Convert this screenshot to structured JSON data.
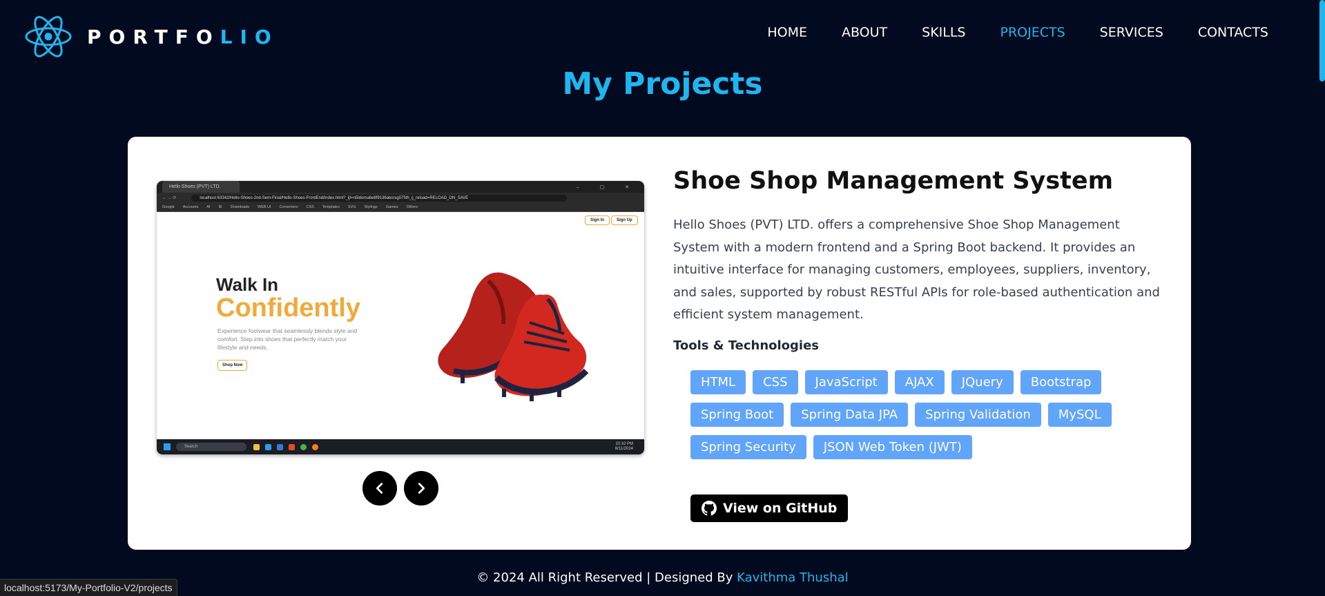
{
  "header": {
    "logo_icon": "react-atom-icon",
    "logo_text_main": "PORTFO",
    "logo_text_accent": "LIO",
    "nav": [
      {
        "label": "HOME",
        "active": false
      },
      {
        "label": "ABOUT",
        "active": false
      },
      {
        "label": "SKILLS",
        "active": false
      },
      {
        "label": "PROJECTS",
        "active": true
      },
      {
        "label": "SERVICES",
        "active": false
      },
      {
        "label": "CONTACTS",
        "active": false
      }
    ]
  },
  "section": {
    "title": "My Projects"
  },
  "project": {
    "title": "Shoe Shop Management System",
    "description": "Hello Shoes (PVT) LTD. offers a comprehensive Shoe Shop Management System with a modern frontend and a Spring Boot backend. It provides an intuitive interface for managing customers, employees, suppliers, inventory, and sales, supported by robust RESTful APIs for role-based authentication and efficient system management.",
    "tools_heading": "Tools & Technologies",
    "tools": [
      "HTML",
      "CSS",
      "JavaScript",
      "AJAX",
      "JQuery",
      "Bootstrap",
      "Spring Boot",
      "Spring Data JPA",
      "Spring Validation",
      "MySQL",
      "Spring Security",
      "JSON Web Token (JWT)"
    ],
    "github_label": "View on GitHub",
    "github_icon": "github-icon",
    "screenshot": {
      "tab_title": "Hello Shoes (PVT) LTD.",
      "url": "localhost:63342/Hello-Shoes-2nd-Sem-Final/Hello-Shoes-FrontEnd/index.html?_ijt=n5ldoma6e8f9136abcrsg075th_ij_reload=RELOAD_ON_SAVE",
      "bookmarks": [
        "Google",
        "Accounts",
        "AI",
        "IE",
        "Downloads",
        "WEB UI",
        "Converters",
        "CSS",
        "Templates",
        "SVG",
        "Stylings",
        "Games",
        "Others"
      ],
      "sign_in": "Sign In",
      "sign_up": "Sign Up",
      "headline_1": "Walk In",
      "headline_2": "Confidently",
      "text": "Experience footwear that seamlessly blends style and comfort. Step into shoes that perfectly match your lifestyle and needs.",
      "shop_now": "Shop Now",
      "taskbar_search": "Search",
      "taskbar_time": "10:10 PM",
      "taskbar_date": "8/11/2024"
    }
  },
  "carousel": {
    "prev_icon": "chevron-left-icon",
    "next_icon": "chevron-right-icon"
  },
  "footer": {
    "text": "© 2024 All Right Reserved | Designed By ",
    "author": "Kavithma Thushal"
  },
  "status_bar": {
    "url": "localhost:5173/My-Portfolio-V2/projects"
  },
  "colors": {
    "background": "#020a1f",
    "accent": "#1fb6f0",
    "tag": "#60a5fa",
    "card": "#ffffff"
  }
}
